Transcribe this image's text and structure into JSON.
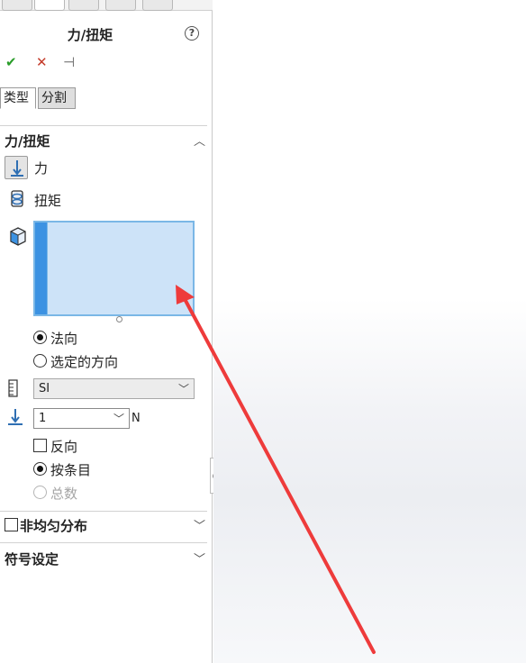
{
  "panel": {
    "title": "力/扭矩",
    "help_icon": "?",
    "actions": {
      "ok": "✔",
      "cancel": "✕",
      "pin": "⊣"
    },
    "tabs": [
      "类型",
      "分割"
    ],
    "force_section": {
      "title": "力/扭矩",
      "force_label": "力",
      "torque_label": "扭矩",
      "radio_normal": "法向",
      "radio_selected_dir": "选定的方向",
      "units_value": "SI",
      "force_value": "1",
      "force_unit": "N",
      "reverse_label": "反向",
      "per_item_label": "按条目",
      "total_label": "总数"
    },
    "nonuniform_label": "非均匀分布",
    "symbol_settings_label": "符号设定"
  },
  "colors": {
    "accent": "#3c92e2",
    "selection_fill": "#cde3f8",
    "arrow": "#ee3b3b",
    "ok": "#2a9d2a",
    "cancel": "#c43b2a"
  }
}
